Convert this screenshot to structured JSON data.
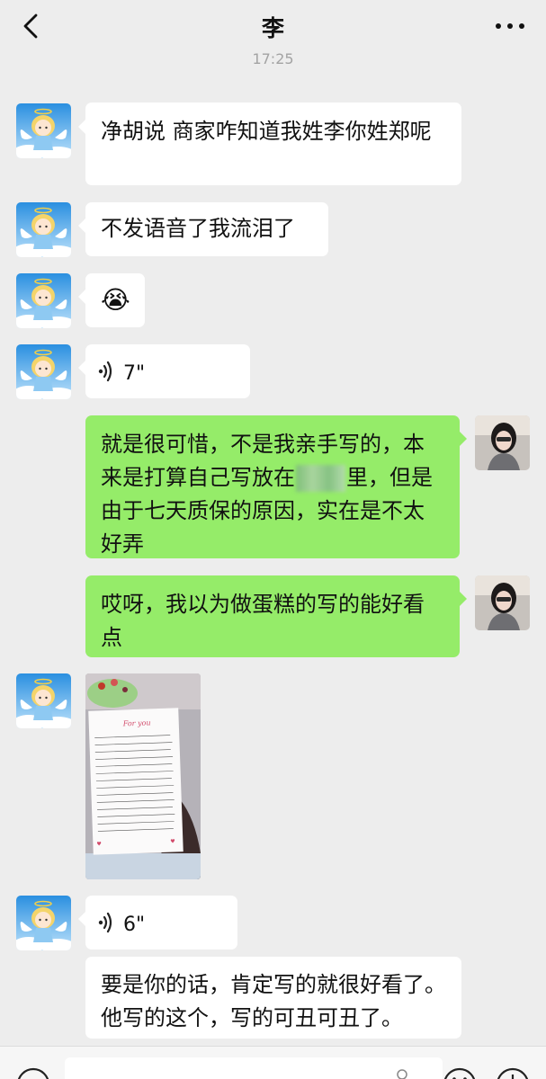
{
  "header": {
    "title": "李",
    "back_icon": "chevron-left-icon",
    "more_icon": "more-dots-icon"
  },
  "timestamp": "17:25",
  "messages": [
    {
      "side": "in",
      "type": "text",
      "text": "净胡说 商家咋知道我姓李你姓郑呢"
    },
    {
      "side": "in",
      "type": "text",
      "text": "不发语音了我流泪了"
    },
    {
      "side": "in",
      "type": "emoji",
      "emoji": "😭"
    },
    {
      "side": "in",
      "type": "voice",
      "duration": "7\""
    },
    {
      "side": "out",
      "type": "text",
      "text_before": "就是很可惜，不是我亲手写的，本来是打算自己写放在",
      "text_after": "里，但是由于七天质保的原因，实在是不太好弄"
    },
    {
      "side": "out",
      "type": "text",
      "text": "哎呀，我以为做蛋糕的写的能好看点"
    },
    {
      "side": "in",
      "type": "image",
      "card_title": "For you"
    },
    {
      "side": "in",
      "type": "voice",
      "duration": "6\""
    },
    {
      "side": "in",
      "type": "text",
      "text": "要是你的话，肯定写的就很好看了。他写的这个，写的可丑可丑了。"
    }
  ],
  "colors": {
    "background": "#ededed",
    "outgoing_bubble": "#95ec69",
    "incoming_bubble": "#ffffff"
  }
}
